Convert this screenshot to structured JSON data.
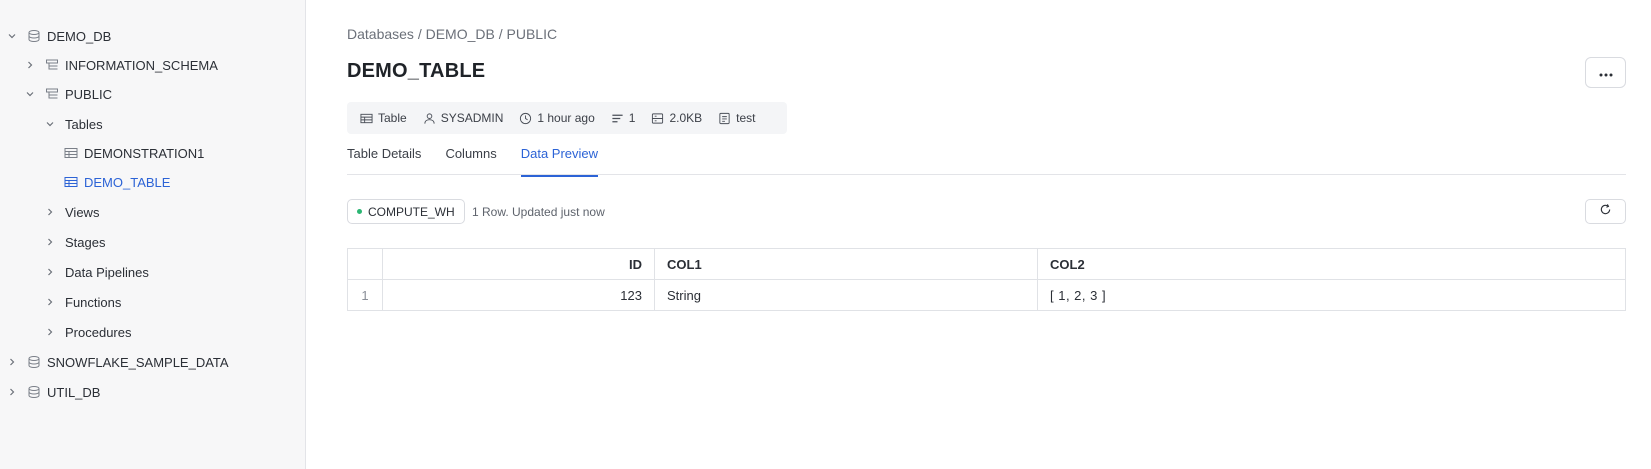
{
  "sidebar": {
    "items": [
      {
        "label": "DEMO_DB",
        "expanded": true,
        "icon": "database-icon"
      },
      {
        "label": "INFORMATION_SCHEMA",
        "expanded": false,
        "icon": "schema-icon"
      },
      {
        "label": "PUBLIC",
        "expanded": true,
        "icon": "schema-icon"
      },
      {
        "label": "Tables",
        "expanded": true
      },
      {
        "label": "DEMONSTRATION1",
        "icon": "table-icon"
      },
      {
        "label": "DEMO_TABLE",
        "icon": "table-icon",
        "active": true
      },
      {
        "label": "Views",
        "expanded": false
      },
      {
        "label": "Stages",
        "expanded": false
      },
      {
        "label": "Data Pipelines",
        "expanded": false
      },
      {
        "label": "Functions",
        "expanded": false
      },
      {
        "label": "Procedures",
        "expanded": false
      },
      {
        "label": "SNOWFLAKE_SAMPLE_DATA",
        "expanded": false,
        "icon": "database-icon"
      },
      {
        "label": "UTIL_DB",
        "expanded": false,
        "icon": "database-icon"
      }
    ]
  },
  "header": {
    "breadcrumb": "Databases / DEMO_DB / PUBLIC",
    "title": "DEMO_TABLE",
    "more_icon": "ellipsis-icon"
  },
  "meta": {
    "type": "Table",
    "owner": "SYSADMIN",
    "updated": "1 hour ago",
    "rows": "1",
    "size": "2.0KB",
    "comment": "test"
  },
  "tabs": [
    {
      "label": "Table Details"
    },
    {
      "label": "Columns"
    },
    {
      "label": "Data Preview",
      "active": true
    }
  ],
  "preview": {
    "warehouse": "COMPUTE_WH",
    "status": "1 Row. Updated just now",
    "columns": [
      "",
      "ID",
      "COL1",
      "COL2"
    ],
    "rows": [
      {
        "n": "1",
        "id": "123",
        "col1": "String",
        "col2": "[ 1, 2, 3 ]"
      }
    ]
  },
  "colors": {
    "accent": "#2c63d6",
    "status_green": "#2bb673"
  }
}
